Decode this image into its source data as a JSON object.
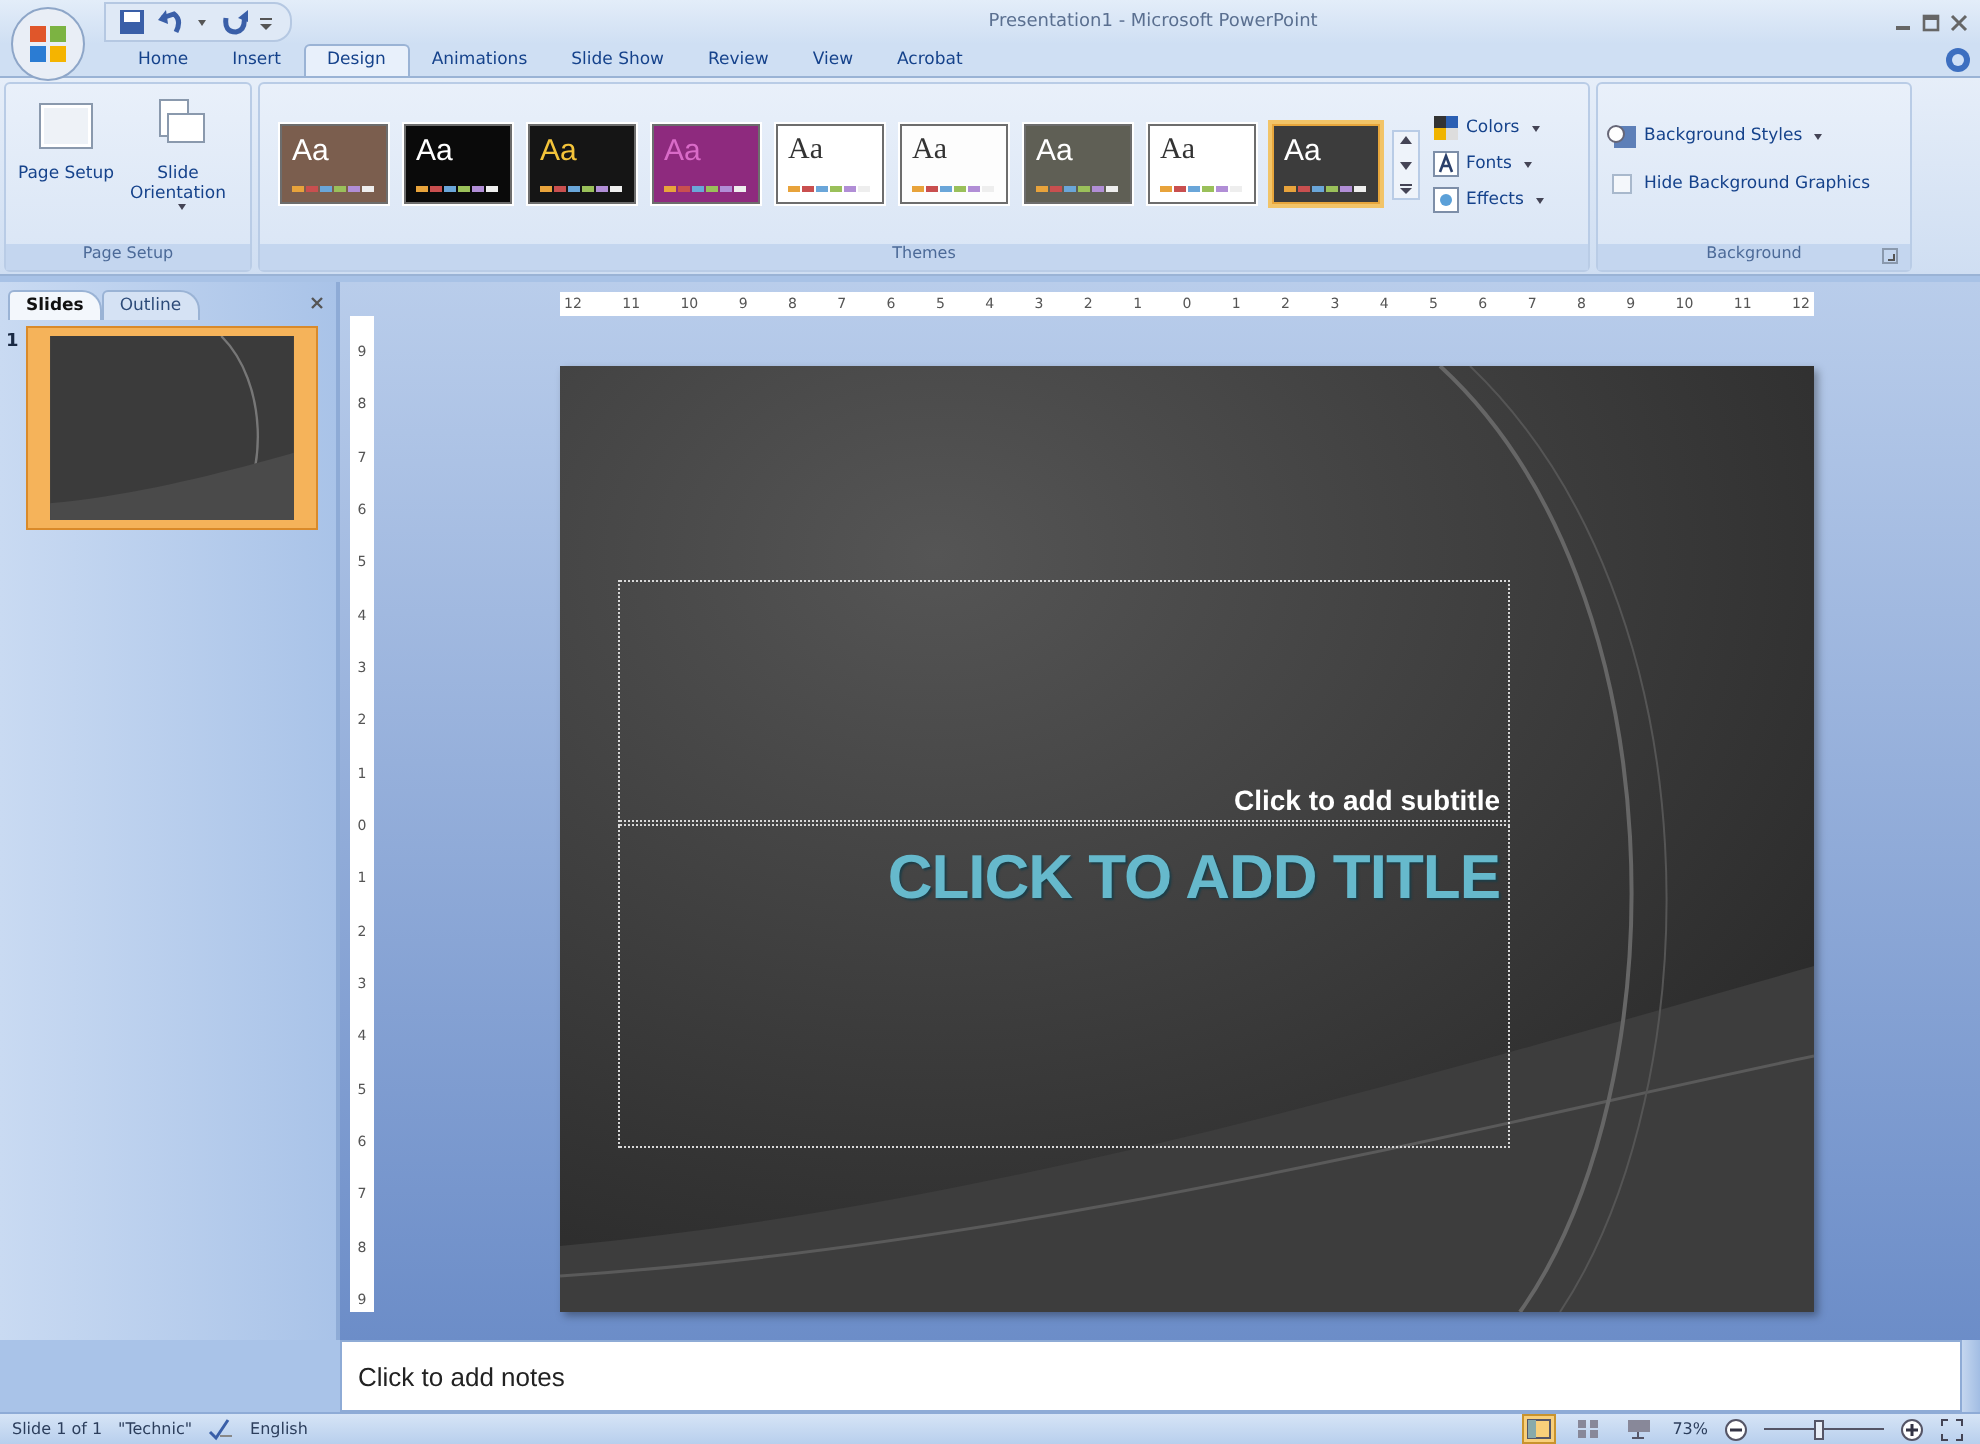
{
  "window": {
    "title": "Presentation1 - Microsoft PowerPoint"
  },
  "tabs": [
    {
      "label": "Home",
      "selected": false
    },
    {
      "label": "Insert",
      "selected": false
    },
    {
      "label": "Design",
      "selected": true
    },
    {
      "label": "Animations",
      "selected": false
    },
    {
      "label": "Slide Show",
      "selected": false
    },
    {
      "label": "Review",
      "selected": false
    },
    {
      "label": "View",
      "selected": false
    },
    {
      "label": "Acrobat",
      "selected": false
    }
  ],
  "page_setup": {
    "label": "Page Setup",
    "buttons": [
      {
        "kind": "setup",
        "label": "Page Setup"
      },
      {
        "kind": "orientation",
        "label": "Slide Orientation"
      }
    ]
  },
  "themes": {
    "label": "Themes",
    "items": [
      {
        "sample": "Aa",
        "kind": "dark",
        "color": "#7b5e4e",
        "selected": false
      },
      {
        "sample": "Aa",
        "kind": "dark",
        "color": "#0a0a0a",
        "selected": false
      },
      {
        "sample": "Aa",
        "kind": "gold",
        "color": "#151515",
        "selected": false
      },
      {
        "sample": "Aa",
        "kind": "pink",
        "color": "#8e2a7e",
        "selected": false
      },
      {
        "sample": "Aa",
        "kind": "light",
        "color": "#ffffff",
        "selected": false
      },
      {
        "sample": "Aa",
        "kind": "light",
        "color": "#fdfdfd",
        "selected": false
      },
      {
        "sample": "Aa",
        "kind": "dark",
        "color": "#5f5f55",
        "selected": false
      },
      {
        "sample": "Aa",
        "kind": "light",
        "color": "#ffffff",
        "selected": false
      },
      {
        "sample": "Aa",
        "kind": "dark",
        "color": "#3c3c3c",
        "selected": true
      }
    ],
    "options": [
      {
        "kind": "colors",
        "label": "Colors"
      },
      {
        "kind": "fonts",
        "label": "Fonts"
      },
      {
        "kind": "effects",
        "label": "Effects"
      }
    ]
  },
  "background": {
    "label": "Background",
    "styles_button": "Background Styles",
    "hide_graphics": {
      "label": "Hide Background Graphics",
      "checked": false
    }
  },
  "pane": {
    "tabs": [
      {
        "label": "Slides",
        "selected": true
      },
      {
        "label": "Outline",
        "selected": false
      }
    ],
    "thumbnails": [
      {
        "number": "1",
        "selected": true
      }
    ]
  },
  "ruler": {
    "horizontal": [
      "12",
      "11",
      "10",
      "9",
      "8",
      "7",
      "6",
      "5",
      "4",
      "3",
      "2",
      "1",
      "0",
      "1",
      "2",
      "3",
      "4",
      "5",
      "6",
      "7",
      "8",
      "9",
      "10",
      "11",
      "12"
    ],
    "vertical": [
      "9",
      "8",
      "7",
      "6",
      "5",
      "4",
      "3",
      "2",
      "1",
      "0",
      "1",
      "2",
      "3",
      "4",
      "5",
      "6",
      "7",
      "8",
      "9"
    ]
  },
  "slide": {
    "subtitle_placeholder": "Click to add subtitle",
    "title_placeholder": "CLICK TO ADD TITLE"
  },
  "notes": {
    "placeholder": "Click to add notes"
  },
  "status_bar": {
    "slide": "Slide 1 of 1",
    "theme": "\"Technic\"",
    "language": "English",
    "views": [
      {
        "kind": "normal",
        "selected": true
      },
      {
        "kind": "sorter",
        "selected": false
      },
      {
        "kind": "show",
        "selected": false
      }
    ],
    "zoom": "73%",
    "zoom_slider": {
      "level": 0.45
    }
  }
}
